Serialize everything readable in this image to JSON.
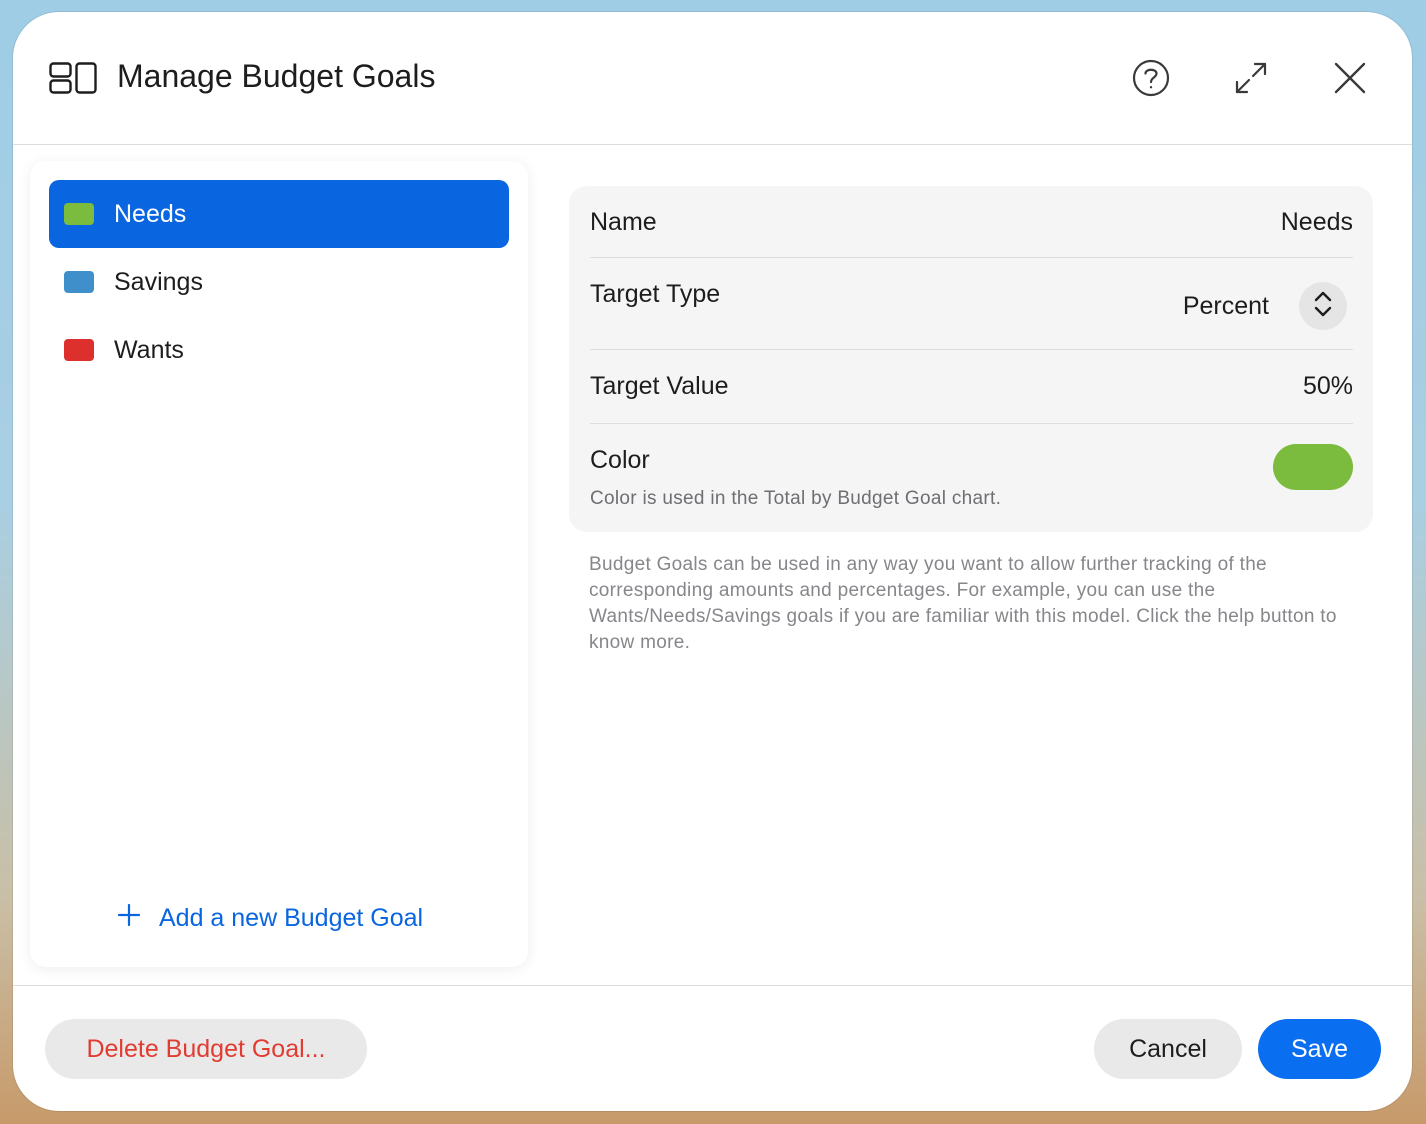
{
  "header": {
    "title": "Manage Budget Goals",
    "icons": {
      "app": "sidebar-layout-icon",
      "help": "question-circle-icon",
      "expand": "expand-arrows-icon",
      "close": "close-x-icon"
    }
  },
  "sidebar": {
    "items": [
      {
        "label": "Needs",
        "color": "#7bbb3e",
        "selected": true
      },
      {
        "label": "Savings",
        "color": "#3f8fca",
        "selected": false
      },
      {
        "label": "Wants",
        "color": "#dd2f2b",
        "selected": false
      }
    ],
    "add_label": "Add a new Budget Goal"
  },
  "detail": {
    "name_label": "Name",
    "name_value": "Needs",
    "target_type_label": "Target Type",
    "target_type_value": "Percent",
    "target_value_label": "Target Value",
    "target_value": "50%",
    "color_label": "Color",
    "color_hint": "Color is used in the Total by Budget Goal chart.",
    "color_value": "#7bbb3e"
  },
  "help_text": "Budget Goals can be used in any way you want to allow further tracking of the corresponding amounts and percentages. For example, you can use the Wants/Needs/Savings goals if you are familiar with this model. Click the help button to know more.",
  "footer": {
    "delete_label": "Delete Budget Goal...",
    "cancel_label": "Cancel",
    "save_label": "Save"
  },
  "colors": {
    "accent": "#0a66e0",
    "destructive": "#e23b32"
  }
}
